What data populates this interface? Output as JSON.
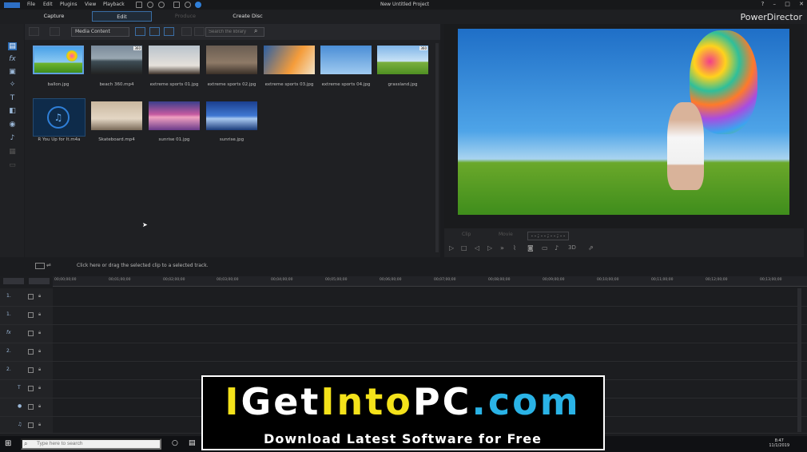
{
  "menu": {
    "file": "File",
    "edit": "Edit",
    "plugins": "Plugins",
    "view": "View",
    "playback": "Playback"
  },
  "window": {
    "title": "New Untitled Project",
    "help": "?",
    "minimize": "–",
    "maximize": "□",
    "close": "✕"
  },
  "tabs": {
    "capture": "Capture",
    "edit": "Edit",
    "produce": "Produce",
    "create_disc": "Create Disc"
  },
  "brand": "PowerDirector",
  "library": {
    "media_select": "Media Content",
    "search_placeholder": "Search the library",
    "items": [
      {
        "label": "ballon.jpg",
        "badge": ""
      },
      {
        "label": "beach 360.mp4",
        "badge": "360"
      },
      {
        "label": "extreme sports 01.jpg",
        "badge": ""
      },
      {
        "label": "extreme sports 02.jpg",
        "badge": ""
      },
      {
        "label": "extreme sports 03.jpg",
        "badge": ""
      },
      {
        "label": "extreme sports 04.jpg",
        "badge": ""
      },
      {
        "label": "grassland.jpg",
        "badge": "360"
      },
      {
        "label": "R You Up for It.m4a",
        "badge": ""
      },
      {
        "label": "Skateboard.mp4",
        "badge": ""
      },
      {
        "label": "sunrise 01.jpg",
        "badge": ""
      },
      {
        "label": "sunrise.jpg",
        "badge": ""
      }
    ]
  },
  "preview": {
    "clip": "Clip",
    "movie": "Movie",
    "timecode": "- - ; - - ; - - ; - -",
    "mode_3d": "3D"
  },
  "timeline": {
    "hint": "Click here or drag the selected clip to a selected track.",
    "ruler": [
      "00;00;00;00",
      "00;01;00;00",
      "00;02;00;00",
      "00;03;00;00",
      "00;04;00;00",
      "00;05;00;00",
      "00;06;00;00",
      "00;07;00;00",
      "00;08;00;00",
      "00;09;00;00",
      "00;10;00;00",
      "00;11;00;00",
      "00;12;00;00",
      "00;13;00;00"
    ],
    "tracks": [
      "1.",
      "1.",
      "fx",
      "2.",
      "2.",
      "T",
      "",
      "♫"
    ]
  },
  "taskbar": {
    "search_placeholder": "Type here to search",
    "time": "8:47",
    "date": "11/1/2019"
  },
  "watermark": {
    "line1_a": "I",
    "line1_b": "Get",
    "line1_c": "Into",
    "line1_d": "PC",
    "line1_e": ".com",
    "line2": "Download Latest Software for Free"
  }
}
